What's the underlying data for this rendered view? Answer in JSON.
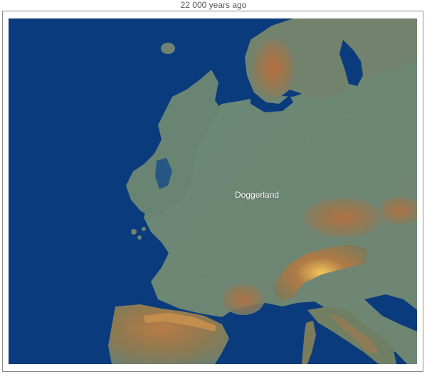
{
  "caption": "22 000 years ago",
  "map": {
    "labels": {
      "doggerland": "Doggerland"
    },
    "colors": {
      "sea": "#0a3b7d",
      "land_low": "#6e8a78",
      "land_mid": "#8a8f6a",
      "highland": "#a7764a",
      "peak": "#e0b24d"
    }
  }
}
